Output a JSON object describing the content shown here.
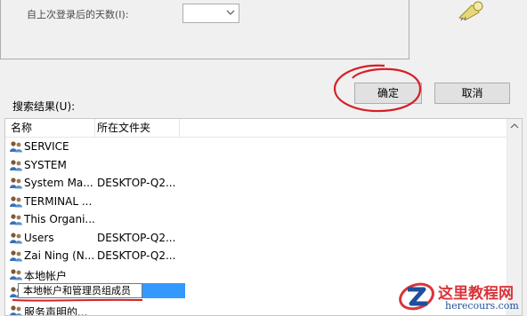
{
  "query": {
    "days_label": "自上次登录后的天数(I):",
    "days_value": ""
  },
  "buttons": {
    "ok_label": "确定",
    "cancel_label": "取消"
  },
  "results": {
    "label": "搜索结果(U):",
    "columns": [
      "名称",
      "所在文件夹"
    ],
    "rows": [
      {
        "name": "SERVICE",
        "folder": ""
      },
      {
        "name": "SYSTEM",
        "folder": ""
      },
      {
        "name": "System Ma...",
        "folder": "DESKTOP-Q2..."
      },
      {
        "name": "TERMINAL ...",
        "folder": ""
      },
      {
        "name": "This Organi...",
        "folder": ""
      },
      {
        "name": "Users",
        "folder": "DESKTOP-Q2..."
      },
      {
        "name": "Zai Ning (N...",
        "folder": "DESKTOP-Q2..."
      },
      {
        "name": "本地帐户",
        "folder": ""
      },
      {
        "name": "",
        "folder": ""
      },
      {
        "name": "服务声明的...",
        "folder": ""
      }
    ],
    "tooltip": "本地帐户和管理员组成员"
  },
  "icons": {
    "user_group": "user-group-icon",
    "search": "search-keys-icon"
  },
  "colors": {
    "selection": "#3399ff",
    "annotation": "#d61f26"
  },
  "watermark": {
    "title": "这里教程网",
    "url": "herecours.com"
  }
}
